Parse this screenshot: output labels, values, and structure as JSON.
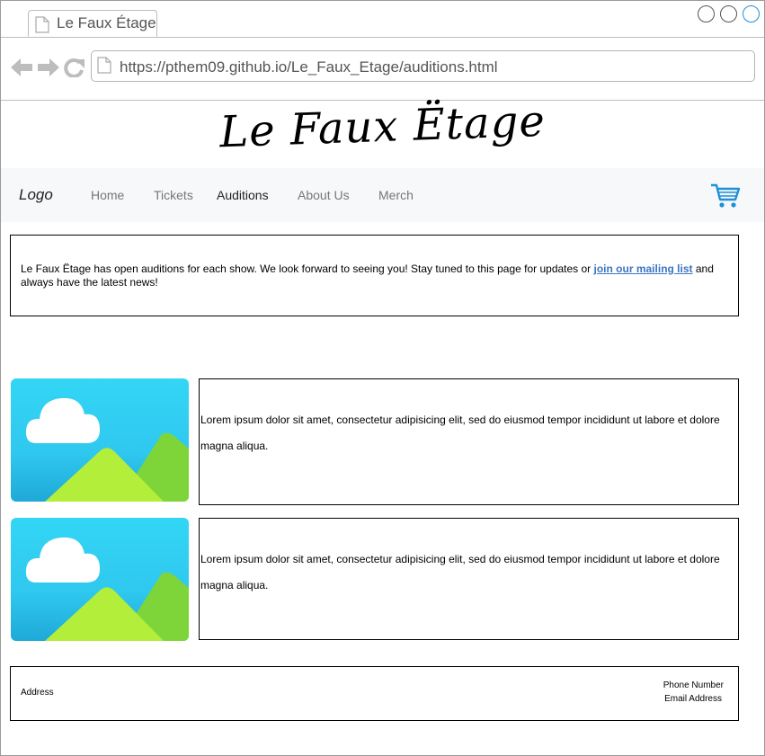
{
  "browser": {
    "tab_title": "Le Faux Étage",
    "url": "https://pthem09.github.io/Le_Faux_Etage/auditions.html",
    "icons": [
      "doc-icon",
      "back-icon",
      "forward-icon",
      "reload-icon"
    ],
    "accent": "#1e90d8"
  },
  "site": {
    "title": "Le Faux Ëtage",
    "logo": "Logo",
    "menu": {
      "home": "Home",
      "tickets": "Tickets",
      "auditions": "Auditions",
      "about": "About Us",
      "merch": "Merch"
    },
    "cart_icon": "cart-icon",
    "cart_color": "#1e90d8"
  },
  "intro": {
    "text_before": "Le Faux Ëtage has open auditions for each show. We look forward to seeing you! Stay tuned to this page for updates or ",
    "link": "join our mailing list",
    "text_after": " and always have the latest news!",
    "link_color": "#3a75c4"
  },
  "cards": [
    {
      "image_icon": "image-placeholder-icon",
      "text": "Lorem ipsum dolor sit amet, consectetur adipisicing elit, sed do eiusmod tempor incididunt ut labore et dolore magna aliqua."
    },
    {
      "image_icon": "image-placeholder-icon",
      "text": "Lorem ipsum dolor sit amet, consectetur adipisicing elit, sed do eiusmod tempor incididunt ut labore et dolore magna aliqua."
    }
  ],
  "footer": {
    "address": "Address",
    "phone": "Phone Number",
    "email": "Email Address"
  }
}
